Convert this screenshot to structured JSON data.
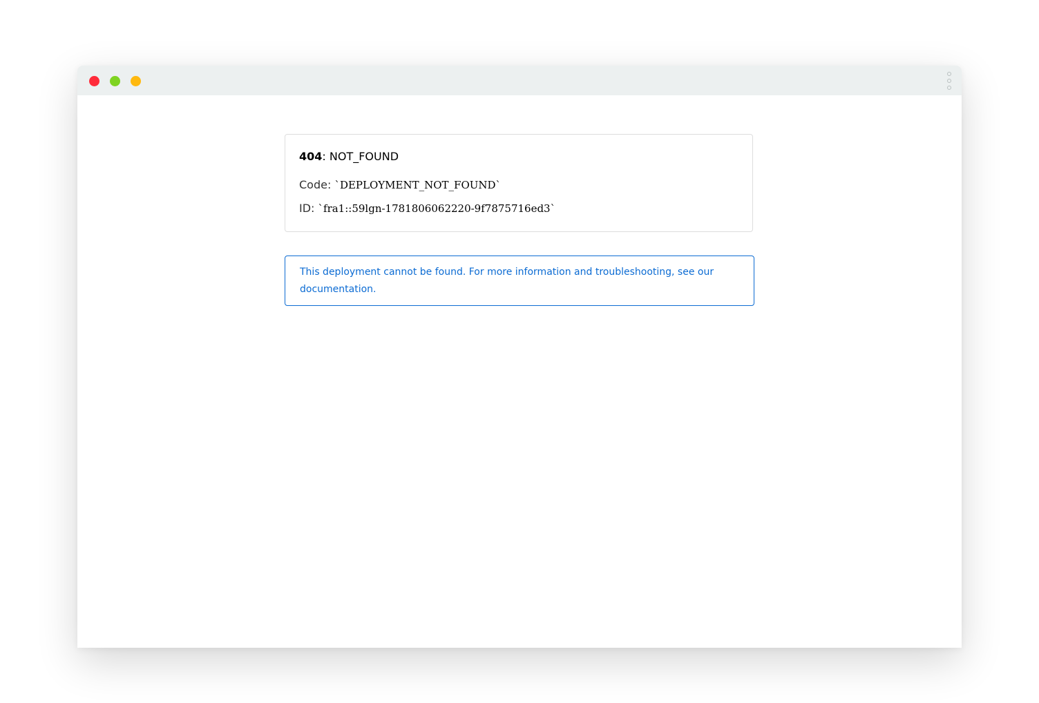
{
  "window": {
    "controls": {
      "close": "red-dot-icon",
      "maximize": "green-dot-icon",
      "minimize": "yellow-dot-icon"
    },
    "menu_icon": "vertical-dots-icon"
  },
  "error": {
    "status_code": "404",
    "separator": ": ",
    "status_text": "NOT_FOUND",
    "code_label": "Code: ",
    "code_value": "`DEPLOYMENT_NOT_FOUND`",
    "id_label": "ID: ",
    "id_value": "`fra1::59lgn-1781806062220-9f7875716ed3`"
  },
  "info": {
    "message": "This deployment cannot be found. For more information and troubleshooting, see our ",
    "link_text": "documentation."
  },
  "colors": {
    "accent_blue": "#0b6bd3",
    "close_red": "#ff2b3a",
    "max_green": "#7ed321",
    "min_yellow": "#ffb90f",
    "titlebar": "#ecf0f0"
  }
}
